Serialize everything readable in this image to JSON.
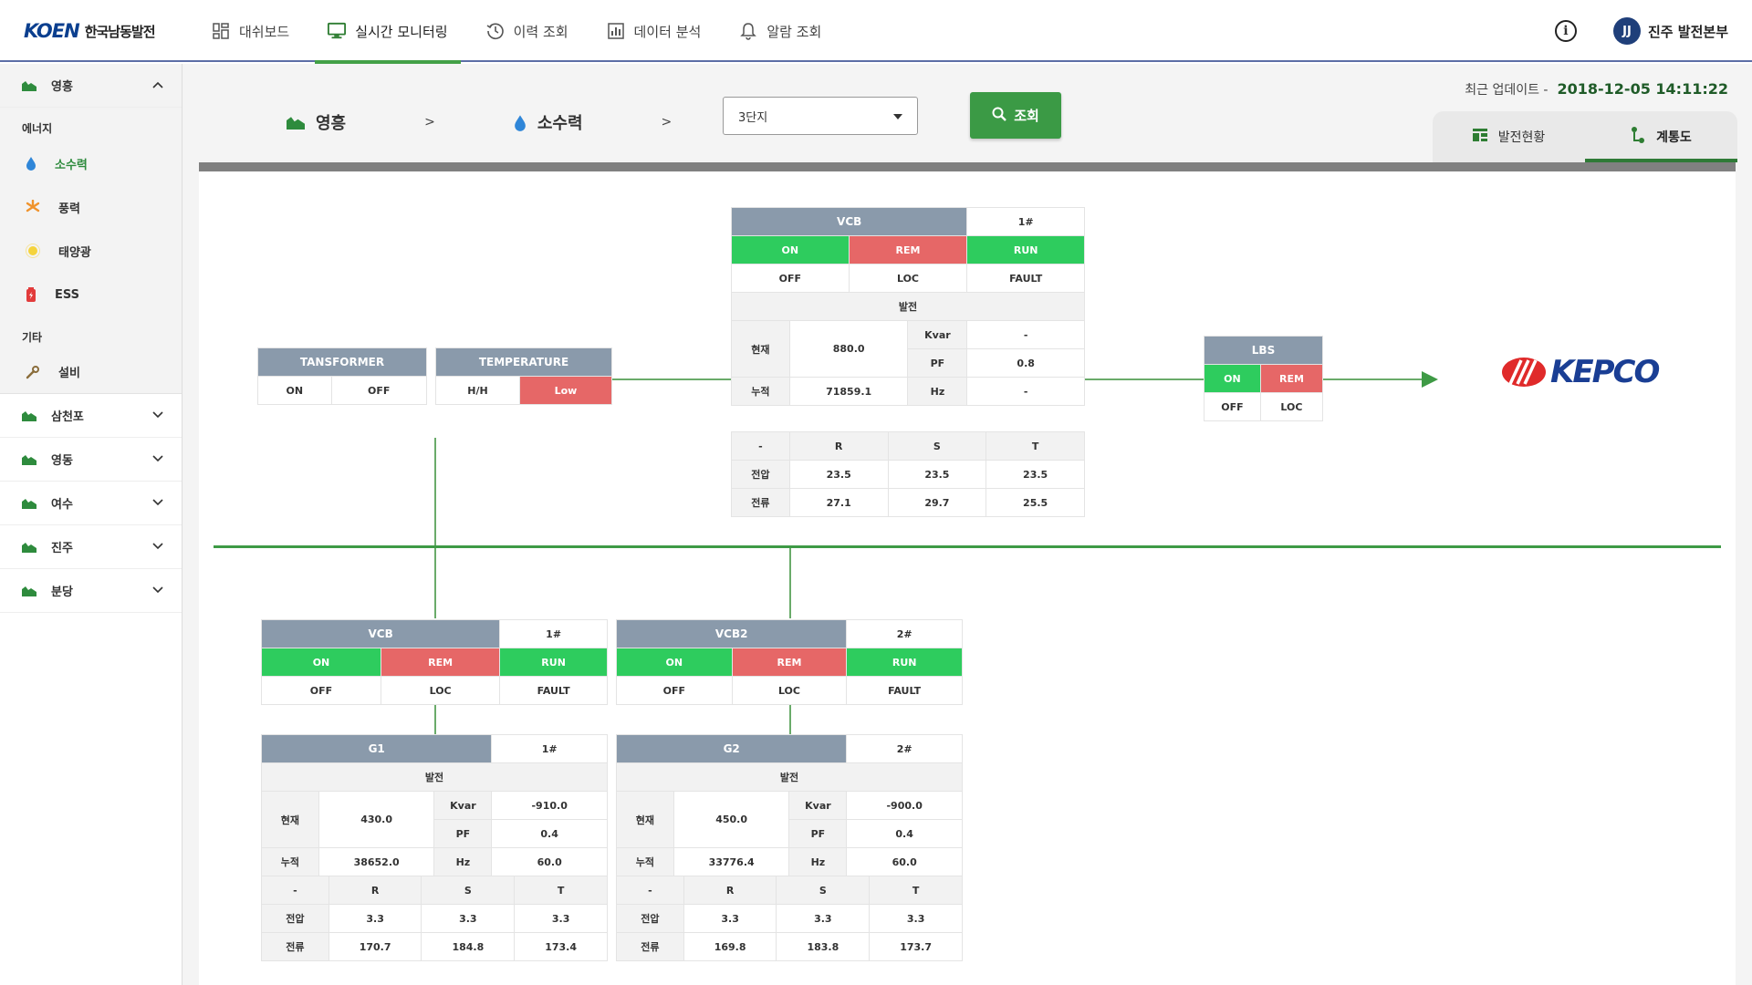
{
  "app": {
    "logo_mark": "KOEN",
    "company": "한국남동발전"
  },
  "nav": {
    "items": [
      {
        "label": "대쉬보드",
        "icon": "dashboard-icon"
      },
      {
        "label": "실시간 모니터링",
        "icon": "monitor-icon",
        "active": true
      },
      {
        "label": "이력 조회",
        "icon": "history-icon"
      },
      {
        "label": "데이터 분석",
        "icon": "chart-icon"
      },
      {
        "label": "알람 조회",
        "icon": "bell-icon"
      }
    ]
  },
  "user": {
    "initials": "JJ",
    "name": "진주 발전본부"
  },
  "sidebar": {
    "open_group": "영흥",
    "section_energy": "에너지",
    "energy_items": [
      {
        "label": "소수력",
        "icon": "drop-icon",
        "active": true
      },
      {
        "label": "풍력",
        "icon": "wind-icon"
      },
      {
        "label": "태양광",
        "icon": "sun-icon"
      },
      {
        "label": "ESS",
        "icon": "battery-icon"
      }
    ],
    "section_other": "기타",
    "other_items": [
      {
        "label": "설비",
        "icon": "wrench-icon"
      }
    ],
    "groups": [
      "삼천포",
      "영동",
      "여수",
      "진주",
      "분당"
    ]
  },
  "header": {
    "crumb_site": "영흥",
    "crumb_energy": "소수력",
    "crumb_sep": ">",
    "select_value": "3단지",
    "search_label": "조회",
    "update_label": "최근 업데이트 -",
    "update_time": "2018-12-05 14:11:22",
    "tab_status": "발전현황",
    "tab_diagram": "계통도"
  },
  "diagram": {
    "transformer": {
      "title": "TANSFORMER",
      "on": "ON",
      "off": "OFF"
    },
    "temperature": {
      "title": "TEMPERATURE",
      "hh": "H/H",
      "low": "Low"
    },
    "vcb_main": {
      "title": "VCB",
      "num": "1#",
      "on": "ON",
      "rem": "REM",
      "run": "RUN",
      "off": "OFF",
      "loc": "LOC",
      "fault": "FAULT",
      "gen": "발전",
      "now_label": "현재",
      "now": "880.0",
      "acc_label": "누적",
      "acc": "71859.1",
      "kvar_label": "Kvar",
      "kvar": "-",
      "pf_label": "PF",
      "pf": "0.8",
      "hz_label": "Hz",
      "hz": "-",
      "dash": "-",
      "r": "R",
      "s": "S",
      "t": "T",
      "volt_label": "전압",
      "volt": [
        "23.5",
        "23.5",
        "23.5"
      ],
      "curr_label": "전류",
      "curr": [
        "27.1",
        "29.7",
        "25.5"
      ]
    },
    "lbs": {
      "title": "LBS",
      "on": "ON",
      "rem": "REM",
      "off": "OFF",
      "loc": "LOC"
    },
    "kepco": "KEPCO",
    "vcb1": {
      "title": "VCB",
      "num": "1#",
      "on": "ON",
      "rem": "REM",
      "run": "RUN",
      "off": "OFF",
      "loc": "LOC",
      "fault": "FAULT"
    },
    "vcb2": {
      "title": "VCB2",
      "num": "2#",
      "on": "ON",
      "rem": "REM",
      "run": "RUN",
      "off": "OFF",
      "loc": "LOC",
      "fault": "FAULT"
    },
    "g1": {
      "title": "G1",
      "num": "1#",
      "gen": "발전",
      "now_label": "현재",
      "now": "430.0",
      "acc_label": "누적",
      "acc": "38652.0",
      "kvar_label": "Kvar",
      "kvar": "-910.0",
      "pf_label": "PF",
      "pf": "0.4",
      "hz_label": "Hz",
      "hz": "60.0",
      "dash": "-",
      "r": "R",
      "s": "S",
      "t": "T",
      "volt_label": "전압",
      "volt": [
        "3.3",
        "3.3",
        "3.3"
      ],
      "curr_label": "전류",
      "curr": [
        "170.7",
        "184.8",
        "173.4"
      ]
    },
    "g2": {
      "title": "G2",
      "num": "2#",
      "gen": "발전",
      "now_label": "현재",
      "now": "450.0",
      "acc_label": "누적",
      "acc": "33776.4",
      "kvar_label": "Kvar",
      "kvar": "-900.0",
      "pf_label": "PF",
      "pf": "0.4",
      "hz_label": "Hz",
      "hz": "60.0",
      "dash": "-",
      "r": "R",
      "s": "S",
      "t": "T",
      "volt_label": "전압",
      "volt": [
        "3.3",
        "3.3",
        "3.3"
      ],
      "curr_label": "전류",
      "curr": [
        "169.8",
        "183.8",
        "173.7"
      ]
    }
  },
  "colors": {
    "accent_green": "#3b9a45",
    "status_on": "#2ecc5e",
    "status_alert": "#e66767",
    "header_gray": "#8a9aab",
    "brand_blue": "#0b3f8f"
  }
}
